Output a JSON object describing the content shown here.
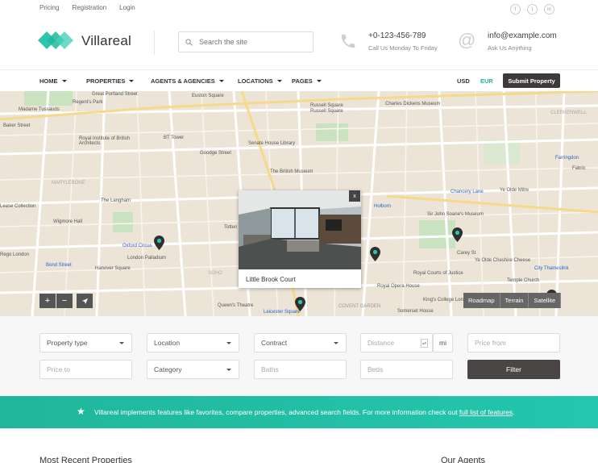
{
  "top_links": [
    "Pricing",
    "Registration",
    "Login"
  ],
  "social": [
    "f",
    "t",
    "in"
  ],
  "brand": {
    "name": "Villareal"
  },
  "search": {
    "placeholder": "Search the site"
  },
  "phone": {
    "number": "+0-123-456-789",
    "note": "Call Us Monday To Friday"
  },
  "email": {
    "address": "info@example.com",
    "note": "Ask Us Anything"
  },
  "nav": {
    "items": [
      "HOME",
      "PROPERTIES",
      "AGENTS & AGENCIES",
      "LOCATIONS",
      "PAGES"
    ],
    "currencies": [
      "USD",
      "EUR"
    ],
    "submit_label": "Submit Property"
  },
  "map": {
    "labels": [
      "Madame Tussauds",
      "Regent's Park",
      "Great Portland Street",
      "Euston Square",
      "Russell Square",
      "Charles Dickens Museum",
      "Baker Street",
      "BT Tower",
      "Goodge Street",
      "Senate House Library",
      "The British Museum",
      "Royal Institute of British Architects",
      "The Langham",
      "Wigmore Hall",
      "Oxford Circus",
      "London Palladium",
      "Bond Street",
      "Hanover Square",
      "Holborn",
      "Chancery Lane",
      "Sir John Soane's Museum",
      "Ye Olde Mitre",
      "Farringdon",
      "Fabric",
      "City Thameslink",
      "Temple Church",
      "Royal Courts of Justice",
      "Royal Opera House",
      "King's College London",
      "Leicester Square",
      "Queen's Theatre",
      "Somerset House",
      "COVENT GARDEN",
      "Ye Olde Cheshire Cheese",
      "Lease Collection",
      "Rego London",
      "Russell Square",
      "Carey St",
      "Totten",
      "SOHO",
      "MARYLEBONE",
      "CLERKENWELL"
    ],
    "types": [
      "Roadmap",
      "Terrain",
      "Satellite"
    ],
    "popup": {
      "title": "Little Brook Court",
      "close": "x"
    },
    "zoom": [
      "+",
      "−"
    ]
  },
  "form": {
    "property_type": "Property type",
    "location": "Location",
    "contract": "Contract",
    "distance": "Distance",
    "distance_unit": "mi",
    "price_from": "Price from",
    "price_to": "Price to",
    "category": "Category",
    "baths": "Baths",
    "beds": "Beds",
    "filter": "Filter"
  },
  "banner": {
    "text": "Villareal implements features like favorites, compare properties, advanced search fields. For more information check out ",
    "link": "full list of features",
    "end": "."
  },
  "sections": {
    "recent": "Most Recent Properties",
    "agents": "Our Agents"
  },
  "colors": {
    "accent": "#1fb79c",
    "dark_button": "#3e3a3a",
    "map_bg": "#ece4d7"
  }
}
